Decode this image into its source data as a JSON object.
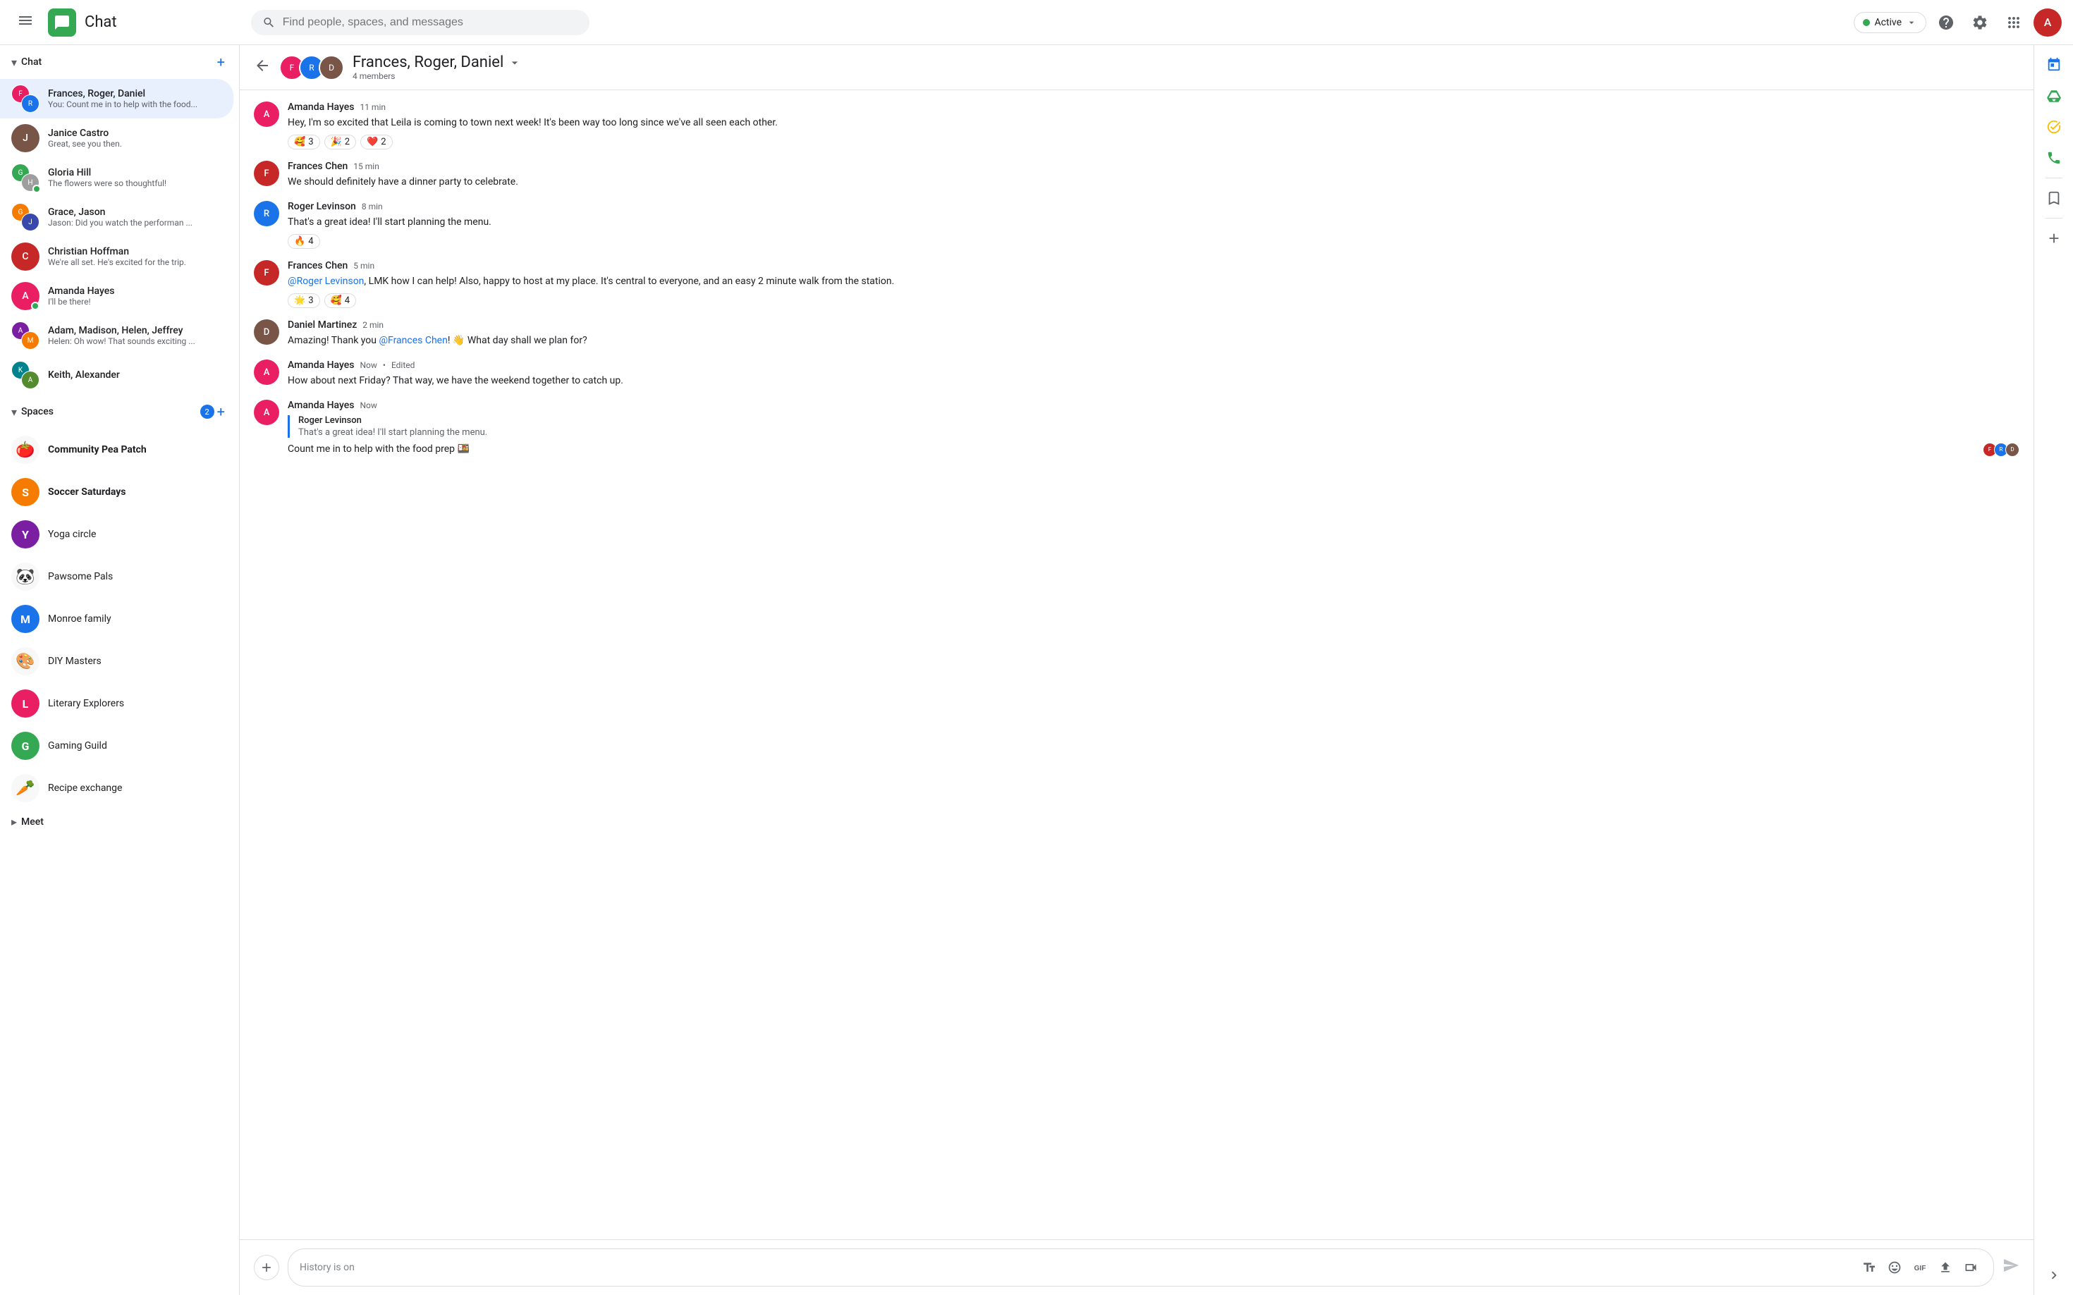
{
  "topbar": {
    "app_title": "Chat",
    "search_placeholder": "Find people, spaces, and messages",
    "status_label": "Active",
    "status_color": "#34a853"
  },
  "sidebar": {
    "chat_section_label": "Chat",
    "spaces_section_label": "Spaces",
    "spaces_badge": "2",
    "meet_section_label": "Meet",
    "chat_items": [
      {
        "id": "frances-roger-daniel",
        "name": "Frances, Roger, Daniel",
        "preview": "You: Count me in to help with the food...",
        "active": true,
        "avatar_type": "multi",
        "av1_color": "#e91e63",
        "av1_text": "F",
        "av2_color": "#1a73e8",
        "av2_text": "R"
      },
      {
        "id": "janice-castro",
        "name": "Janice Castro",
        "preview": "Great, see you then.",
        "active": false,
        "avatar_type": "single",
        "av_color": "#795548",
        "av_text": "J",
        "online": false
      },
      {
        "id": "gloria-hill",
        "name": "Gloria Hill",
        "preview": "The flowers were so thoughtful!",
        "active": false,
        "avatar_type": "multi",
        "av1_color": "#34a853",
        "av1_text": "G",
        "av2_color": "#9e9e9e",
        "av2_text": "H",
        "online": true
      },
      {
        "id": "grace-jason",
        "name": "Grace, Jason",
        "preview": "Jason: Did you watch the performan ...",
        "active": false,
        "avatar_type": "multi",
        "av1_color": "#f57c00",
        "av1_text": "G",
        "av2_color": "#3949ab",
        "av2_text": "J"
      },
      {
        "id": "christian-hoffman",
        "name": "Christian Hoffman",
        "preview": "We're all set.  He's excited for the trip.",
        "active": false,
        "avatar_type": "single",
        "av_color": "#c62828",
        "av_text": "C",
        "online": false
      },
      {
        "id": "amanda-hayes",
        "name": "Amanda Hayes",
        "preview": "I'll be there!",
        "active": false,
        "avatar_type": "single",
        "av_color": "#e91e63",
        "av_text": "A",
        "online": true
      },
      {
        "id": "adam-madison-helen-jeffrey",
        "name": "Adam, Madison, Helen, Jeffrey",
        "preview": "Helen: Oh wow! That sounds exciting ...",
        "active": false,
        "avatar_type": "multi",
        "av1_color": "#7b1fa2",
        "av1_text": "A",
        "av2_color": "#f57c00",
        "av2_text": "M"
      },
      {
        "id": "keith-alexander",
        "name": "Keith, Alexander",
        "preview": "",
        "active": false,
        "avatar_type": "multi",
        "av1_color": "#00838f",
        "av1_text": "K",
        "av2_color": "#558b2f",
        "av2_text": "A"
      }
    ],
    "space_items": [
      {
        "id": "community-pea-patch",
        "name": "Community Pea Patch",
        "bold": true,
        "emoji": "🍅"
      },
      {
        "id": "soccer-saturdays",
        "name": "Soccer Saturdays",
        "bold": true,
        "emoji": "S",
        "emoji_bg": "#f57c00"
      },
      {
        "id": "yoga-circle",
        "name": "Yoga circle",
        "bold": false,
        "emoji": "Y",
        "emoji_bg": "#7b1fa2"
      },
      {
        "id": "pawsome-pals",
        "name": "Pawsome Pals",
        "bold": false,
        "emoji": "🐼"
      },
      {
        "id": "monroe-family",
        "name": "Monroe family",
        "bold": false,
        "emoji": "M",
        "emoji_bg": "#1a73e8"
      },
      {
        "id": "diy-masters",
        "name": "DIY Masters",
        "bold": false,
        "emoji": "🎨"
      },
      {
        "id": "literary-explorers",
        "name": "Literary Explorers",
        "bold": false,
        "emoji": "L",
        "emoji_bg": "#e91e63"
      },
      {
        "id": "gaming-guild",
        "name": "Gaming Guild",
        "bold": false,
        "emoji": "G",
        "emoji_bg": "#34a853"
      },
      {
        "id": "recipe-exchange",
        "name": "Recipe exchange",
        "bold": false,
        "emoji": "🥕"
      }
    ]
  },
  "chat_header": {
    "title": "Frances, Roger, Daniel",
    "members_count": "4 members"
  },
  "messages": [
    {
      "id": "msg1",
      "sender": "Amanda Hayes",
      "time": "11 min",
      "avatar_color": "#e91e63",
      "avatar_text": "A",
      "text": "Hey, I'm so excited that Leila is coming to town next week! It's been way too long since we've all seen each other.",
      "reactions": [
        {
          "emoji": "🥰",
          "count": "3"
        },
        {
          "emoji": "🎉",
          "count": "2"
        },
        {
          "emoji": "❤️",
          "count": "2"
        }
      ]
    },
    {
      "id": "msg2",
      "sender": "Frances Chen",
      "time": "15 min",
      "avatar_color": "#c62828",
      "avatar_text": "F",
      "text": "We should definitely have a dinner party to celebrate.",
      "reactions": []
    },
    {
      "id": "msg3",
      "sender": "Roger Levinson",
      "time": "8 min",
      "avatar_color": "#1a73e8",
      "avatar_text": "R",
      "text": "That's a great idea! I'll start planning the menu.",
      "reactions": [
        {
          "emoji": "🔥",
          "count": "4"
        }
      ]
    },
    {
      "id": "msg4",
      "sender": "Frances Chen",
      "time": "5 min",
      "avatar_color": "#c62828",
      "avatar_text": "F",
      "text_parts": [
        {
          "type": "mention",
          "text": "@Roger Levinson"
        },
        {
          "type": "normal",
          "text": ", LMK how I can help!  Also, happy to host at my place. It's central to everyone, and an easy 2 minute walk from the station."
        }
      ],
      "reactions": [
        {
          "emoji": "🌟",
          "count": "3"
        },
        {
          "emoji": "🥰",
          "count": "4"
        }
      ]
    },
    {
      "id": "msg5",
      "sender": "Daniel Martinez",
      "time": "2 min",
      "avatar_color": "#795548",
      "avatar_text": "D",
      "text_parts": [
        {
          "type": "normal",
          "text": "Amazing! Thank you "
        },
        {
          "type": "mention",
          "text": "@Frances Chen"
        },
        {
          "type": "normal",
          "text": "! 👋 What day shall we plan for?"
        }
      ],
      "reactions": []
    },
    {
      "id": "msg6",
      "sender": "Amanda Hayes",
      "time": "Now",
      "edited": true,
      "avatar_color": "#e91e63",
      "avatar_text": "A",
      "text": "How about next Friday? That way, we have the weekend together to catch up.",
      "reactions": []
    },
    {
      "id": "msg7",
      "sender": "Amanda Hayes",
      "time": "Now",
      "avatar_color": "#e91e63",
      "avatar_text": "A",
      "has_quote": true,
      "quote_name": "Roger Levinson",
      "quote_text": "That's a great idea! I'll start planning the menu.",
      "text": "Count me in to help with the food prep 🍱",
      "show_seen": true,
      "reactions": []
    }
  ],
  "input": {
    "placeholder": "History is on"
  },
  "right_rail": {
    "icons": [
      "calendar",
      "drive",
      "tasks",
      "phone",
      "bookmark",
      "add"
    ]
  }
}
